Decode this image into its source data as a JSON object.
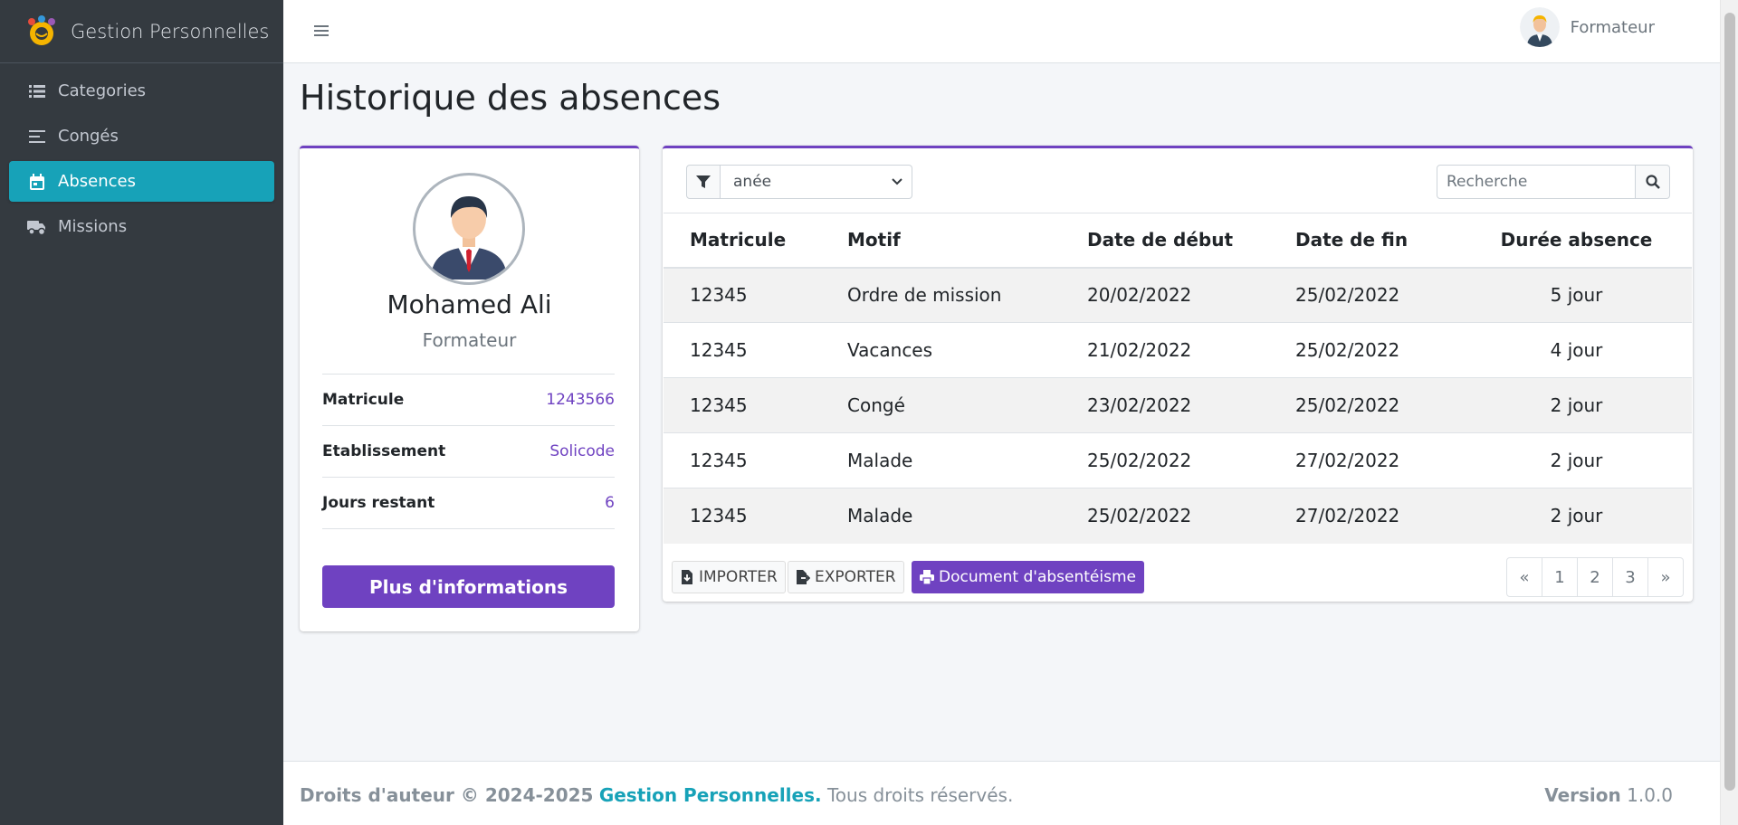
{
  "brand": {
    "name": "Gestion Personnelles"
  },
  "sidebar": {
    "items": [
      {
        "label": "Categories",
        "icon": "list-icon",
        "active": false
      },
      {
        "label": "Congés",
        "icon": "bars-icon",
        "active": false
      },
      {
        "label": "Absences",
        "icon": "calendar-icon",
        "active": true
      },
      {
        "label": "Missions",
        "icon": "truck-icon",
        "active": false
      }
    ]
  },
  "topbar": {
    "user_name": "Formateur"
  },
  "page": {
    "title": "Historique des absences"
  },
  "profile": {
    "name": "Mohamed Ali",
    "role": "Formateur",
    "fields": [
      {
        "label": "Matricule",
        "value": "1243566"
      },
      {
        "label": "Etablissement",
        "value": "Solicode"
      },
      {
        "label": "Jours restant",
        "value": "6"
      }
    ],
    "more_button": "Plus d'informations"
  },
  "filter": {
    "selected": "anée"
  },
  "search": {
    "placeholder": "Recherche"
  },
  "table": {
    "headers": [
      "Matricule",
      "Motif",
      "Date de début",
      "Date de fin",
      "Durée absence"
    ],
    "rows": [
      [
        "12345",
        "Ordre de mission",
        "20/02/2022",
        "25/02/2022",
        "5 jour"
      ],
      [
        "12345",
        "Vacances",
        "21/02/2022",
        "25/02/2022",
        "4 jour"
      ],
      [
        "12345",
        "Congé",
        "23/02/2022",
        "25/02/2022",
        "2 jour"
      ],
      [
        "12345",
        "Malade",
        "25/02/2022",
        "27/02/2022",
        "2 jour"
      ],
      [
        "12345",
        "Malade",
        "25/02/2022",
        "27/02/2022",
        "2 jour"
      ]
    ]
  },
  "actions": {
    "import": "IMPORTER",
    "export": "EXPORTER",
    "document": "Document d'absentéisme"
  },
  "pagination": {
    "prev": "«",
    "pages": [
      "1",
      "2",
      "3"
    ],
    "next": "»"
  },
  "footer": {
    "copyright": "Droits d'auteur © 2024-2025",
    "brand": "Gestion Personnelles.",
    "rights": "Tous droits réservés.",
    "version_label": "Version",
    "version": "1.0.0"
  },
  "colors": {
    "accent": "#6f42c1",
    "active": "#17a2b8",
    "sidebar": "#343a40"
  }
}
